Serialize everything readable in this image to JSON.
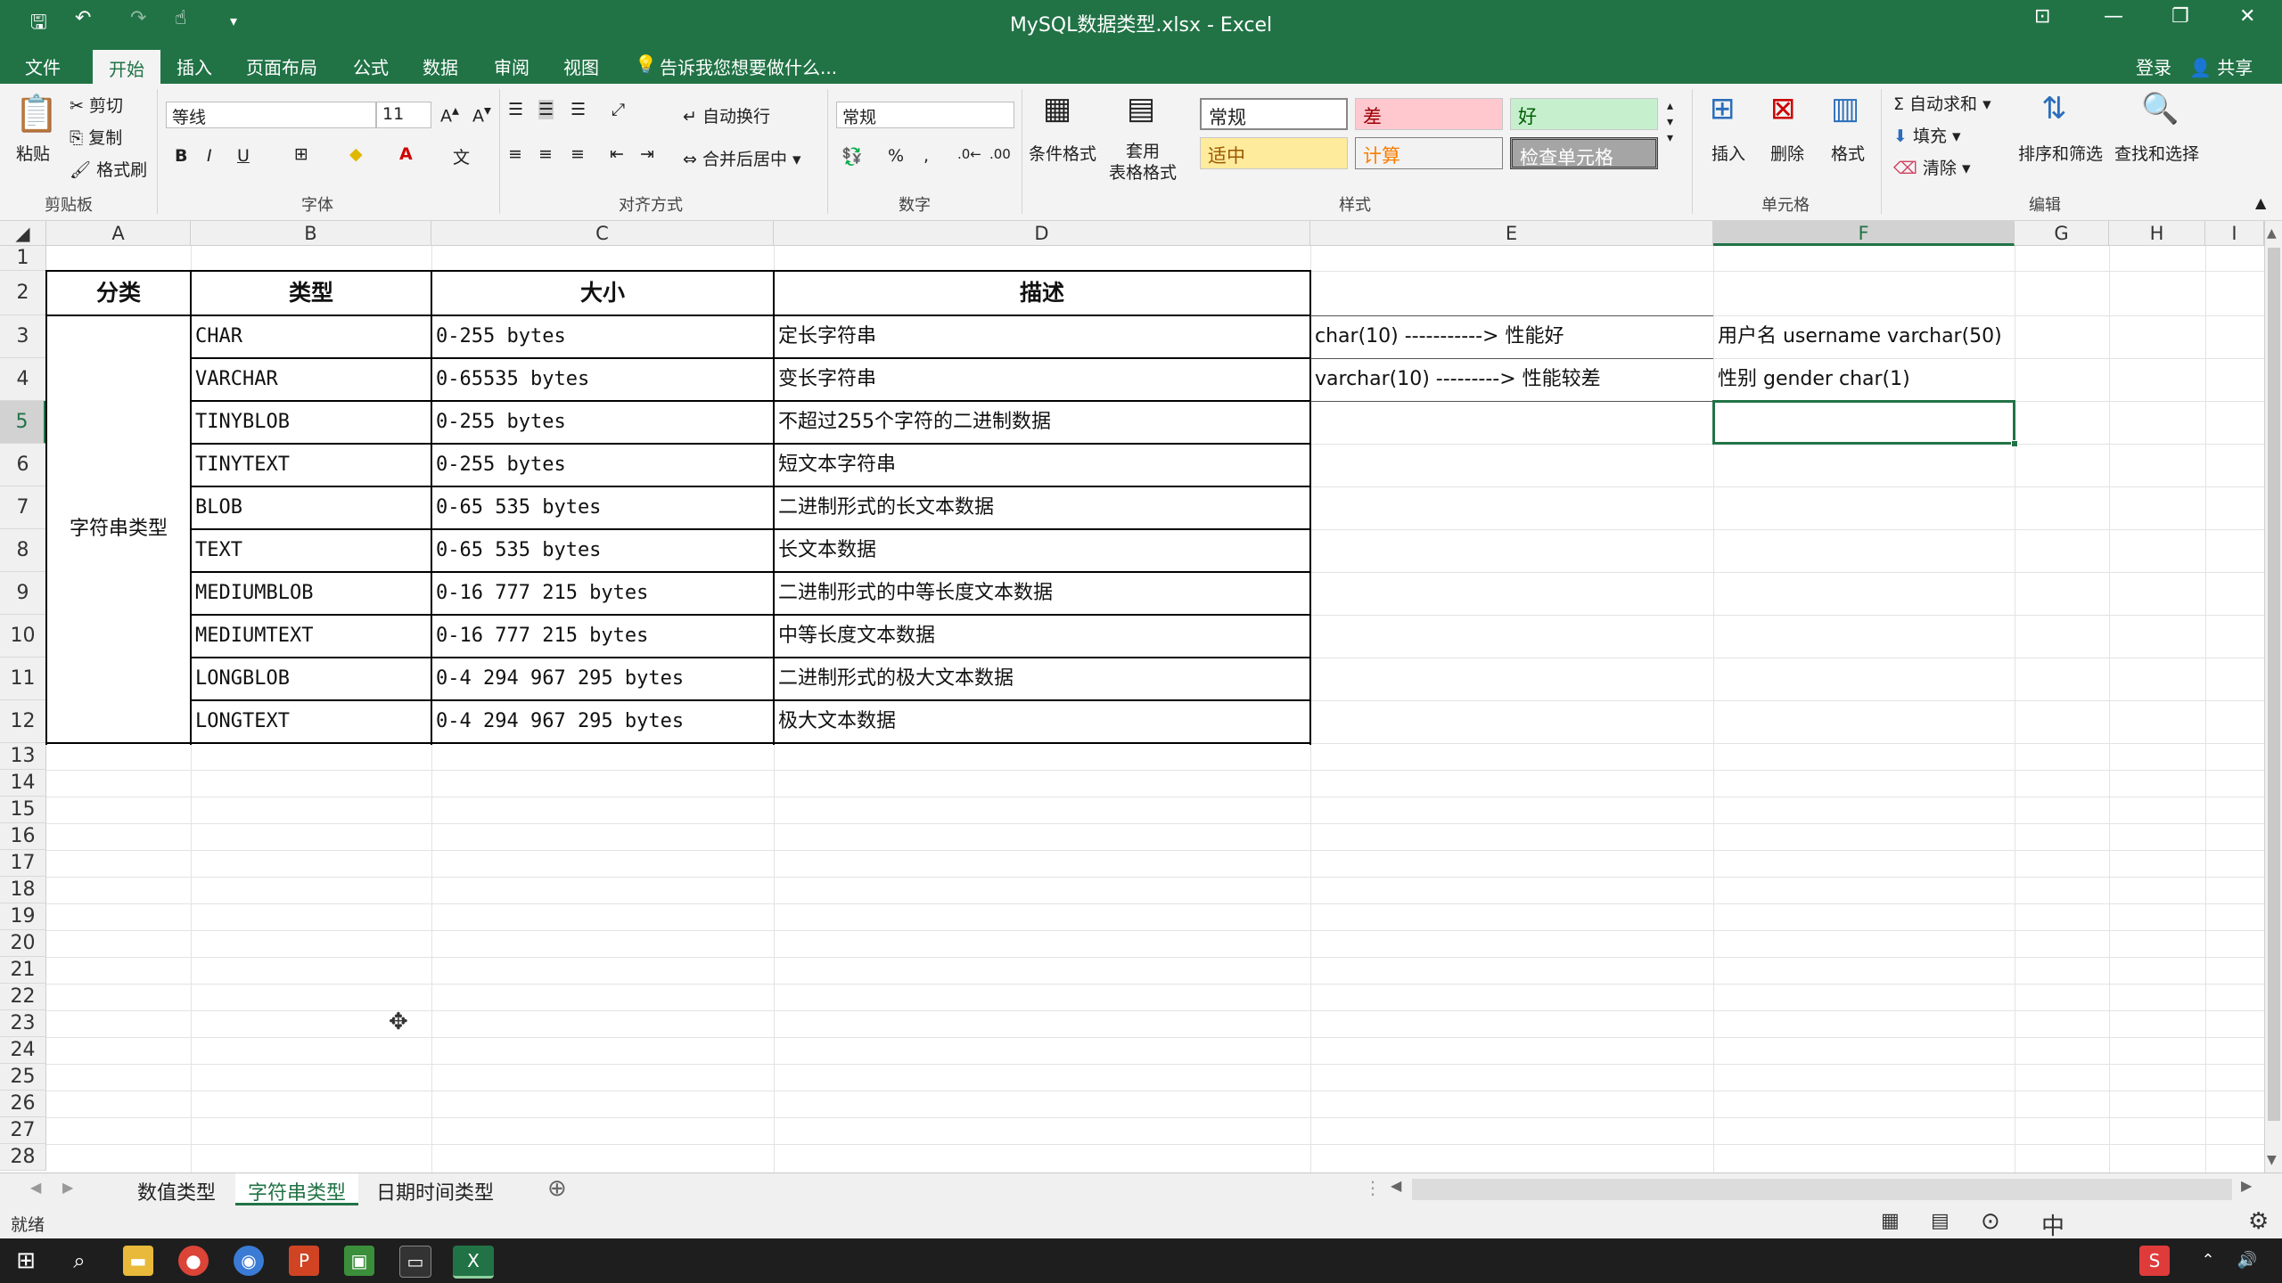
{
  "window": {
    "title": "MySQL数据类型.xlsx - Excel"
  },
  "tabs": [
    "文件",
    "开始",
    "插入",
    "页面布局",
    "公式",
    "数据",
    "审阅",
    "视图"
  ],
  "tell_me": "告诉我您想要做什么...",
  "account": {
    "login": "登录",
    "share": "共享"
  },
  "ribbon": {
    "clipboard": {
      "paste": "粘贴",
      "cut": "剪切",
      "copy": "复制",
      "format_painter": "格式刷",
      "label": "剪贴板"
    },
    "font": {
      "name": "等线",
      "size": "11",
      "label": "字体"
    },
    "alignment": {
      "wrap": "自动换行",
      "merge": "合并后居中",
      "label": "对齐方式"
    },
    "number": {
      "format": "常规",
      "label": "数字"
    },
    "styles": {
      "conditional": "条件格式",
      "table": "套用\n表格格式",
      "normal": "常规",
      "bad": "差",
      "good": "好",
      "neutral": "适中",
      "calc": "计算",
      "check": "检查单元格",
      "label": "样式"
    },
    "cells": {
      "insert": "插入",
      "delete": "删除",
      "format": "格式",
      "label": "单元格"
    },
    "editing": {
      "autosum": "自动求和",
      "fill": "填充",
      "clear": "清除",
      "sort": "排序和筛选",
      "find": "查找和选择",
      "label": "编辑"
    }
  },
  "columns": [
    "A",
    "B",
    "C",
    "D",
    "E",
    "F",
    "G",
    "H",
    "I"
  ],
  "rows": [
    "1",
    "2",
    "3",
    "4",
    "5",
    "6",
    "7",
    "8",
    "9",
    "10",
    "11",
    "12",
    "13",
    "14",
    "15",
    "16",
    "17",
    "18",
    "19",
    "20",
    "21",
    "22",
    "23",
    "24",
    "25",
    "26",
    "27",
    "28"
  ],
  "table": {
    "headers": [
      "分类",
      "类型",
      "大小",
      "描述"
    ],
    "category": "字符串类型",
    "records": [
      [
        "CHAR",
        "0-255 bytes",
        "定长字符串"
      ],
      [
        "VARCHAR",
        "0-65535 bytes",
        "变长字符串"
      ],
      [
        "TINYBLOB",
        "0-255 bytes",
        "不超过255个字符的二进制数据"
      ],
      [
        "TINYTEXT",
        "0-255 bytes",
        "短文本字符串"
      ],
      [
        "BLOB",
        "0-65 535 bytes",
        "二进制形式的长文本数据"
      ],
      [
        "TEXT",
        "0-65 535 bytes",
        "长文本数据"
      ],
      [
        "MEDIUMBLOB",
        "0-16 777 215 bytes",
        "二进制形式的中等长度文本数据"
      ],
      [
        "MEDIUMTEXT",
        "0-16 777 215 bytes",
        "中等长度文本数据"
      ],
      [
        "LONGBLOB",
        "0-4 294 967 295 bytes",
        "二进制形式的极大文本数据"
      ],
      [
        "LONGTEXT",
        "0-4 294 967 295 bytes",
        "极大文本数据"
      ]
    ]
  },
  "notes": {
    "e3": "char(10) -----------> 性能好",
    "e4": "varchar(10) ---------> 性能较差",
    "f3": "用户名  username  varchar(50)",
    "f4": "性别  gender  char(1)"
  },
  "sheets": [
    "数值类型",
    "字符串类型",
    "日期时间类型"
  ],
  "status": "就绪",
  "colors": {
    "excel_green": "#217346",
    "bad_bg": "#ffc7ce",
    "bad_fg": "#9c0006",
    "good_bg": "#c6efce",
    "good_fg": "#006100",
    "neutral_bg": "#ffeb9c",
    "neutral_fg": "#9c5700",
    "check_bg": "#a5a5a5"
  }
}
